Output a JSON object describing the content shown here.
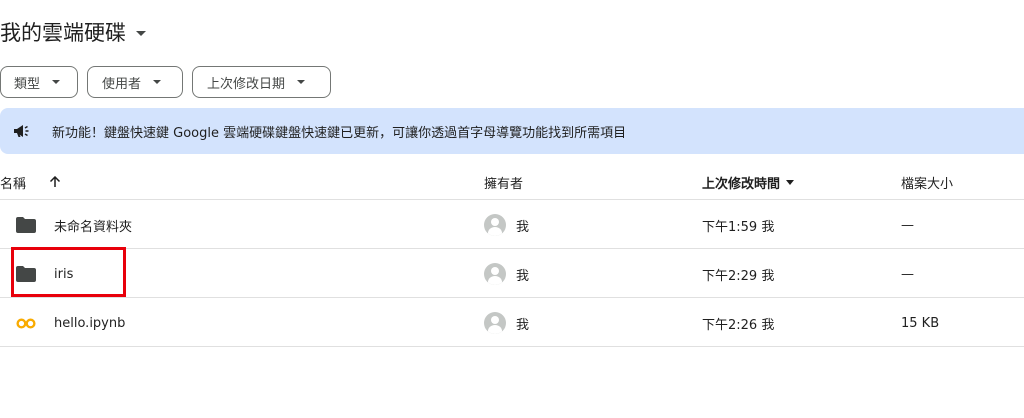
{
  "header": {
    "title": "我的雲端硬碟"
  },
  "filters": [
    {
      "label": "類型"
    },
    {
      "label": "使用者"
    },
    {
      "label": "上次修改日期"
    }
  ],
  "banner": {
    "text": "新功能！鍵盤快速鍵 Google 雲端硬碟鍵盤快速鍵已更新，可讓你透過首字母導覽功能找到所需項目",
    "icon": "megaphone-icon",
    "background": "#d3e3fd"
  },
  "table": {
    "columns": {
      "name": "名稱",
      "owner": "擁有者",
      "modified": "上次修改時間",
      "size": "檔案大小"
    },
    "rows": [
      {
        "icon": "folder-icon",
        "name": "未命名資料夾",
        "owner": "我",
        "modified": "下午1:59 我",
        "size": "—"
      },
      {
        "icon": "folder-icon",
        "name": "iris",
        "owner": "我",
        "modified": "下午2:29 我",
        "size": "—"
      },
      {
        "icon": "colab-icon",
        "name": "hello.ipynb",
        "owner": "我",
        "modified": "下午2:26 我",
        "size": "15 KB"
      }
    ]
  },
  "colors": {
    "highlight_box": "#e8000b",
    "colab_orange": "#f9ab00",
    "folder": "#444746"
  }
}
